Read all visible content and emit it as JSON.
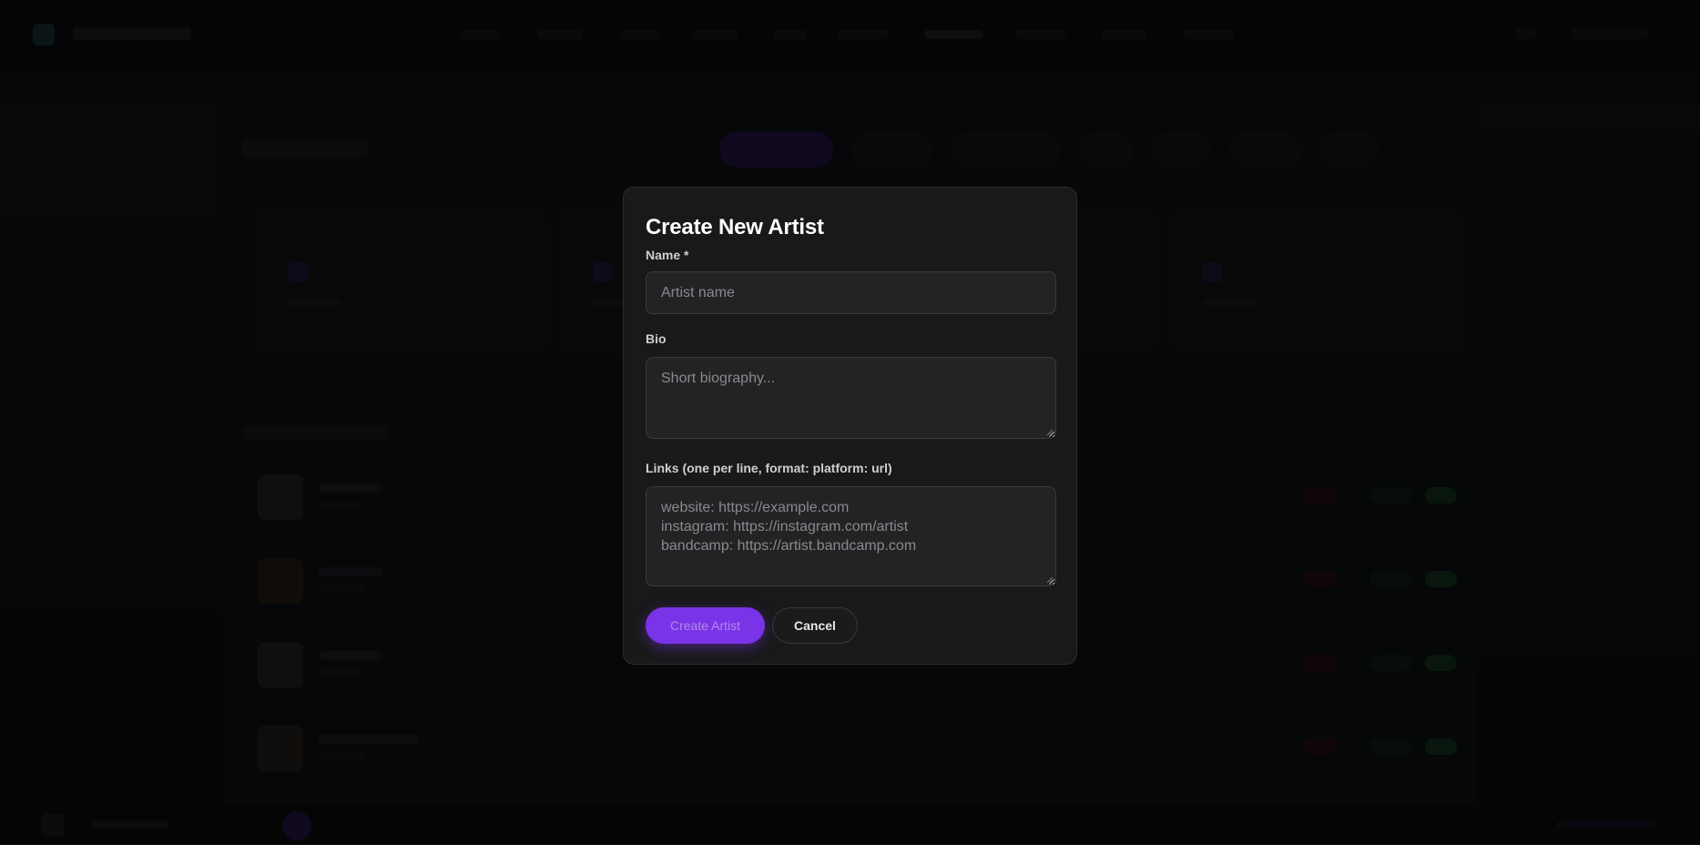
{
  "modal": {
    "title": "Create New Artist",
    "name_label": "Name *",
    "name_placeholder": "Artist name",
    "bio_label": "Bio",
    "bio_placeholder": "Short biography...",
    "links_label": "Links (one per line, format: platform: url)",
    "links_placeholder": "website: https://example.com\ninstagram: https://instagram.com/artist\nbandcamp: https://artist.bandcamp.com",
    "create_button": "Create Artist",
    "cancel_button": "Cancel"
  },
  "colors": {
    "accent": "#7b33e8",
    "modal_background": "#19191a",
    "overlay": "rgba(0,0,0,0.62)"
  }
}
